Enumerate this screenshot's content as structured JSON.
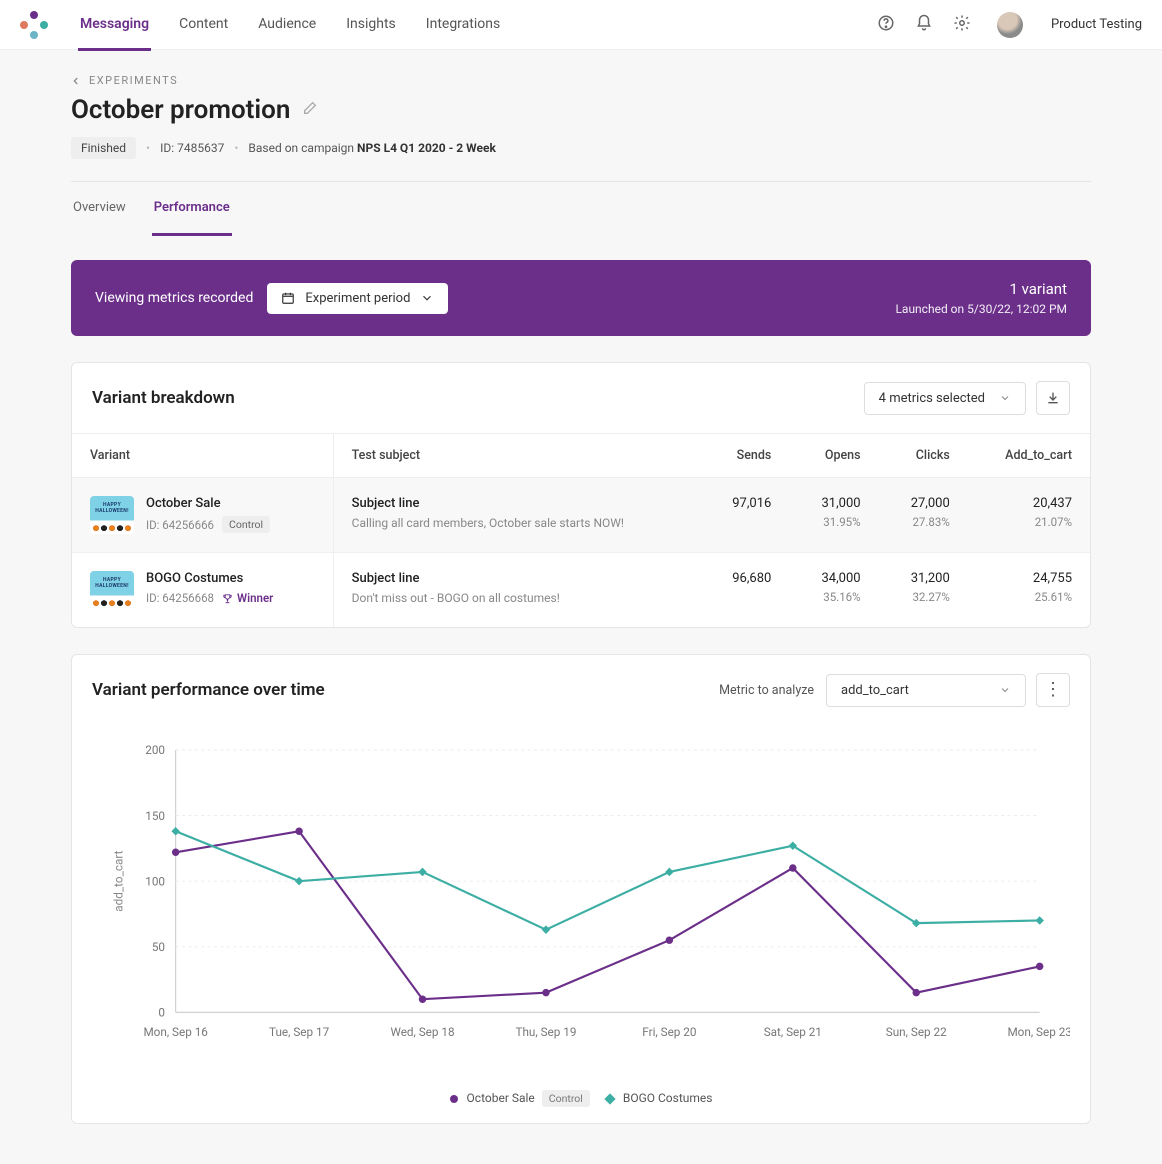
{
  "nav": {
    "items": [
      {
        "label": "Messaging",
        "active": true
      },
      {
        "label": "Content"
      },
      {
        "label": "Audience"
      },
      {
        "label": "Insights"
      },
      {
        "label": "Integrations"
      }
    ],
    "user_label": "Product Testing"
  },
  "header": {
    "breadcrumb": "EXPERIMENTS",
    "title": "October promotion",
    "status_badge": "Finished",
    "id_label": "ID: 7485637",
    "based_on_prefix": "Based on campaign ",
    "based_on_value": "NPS L4 Q1 2020 - 2 Week",
    "tabs": [
      {
        "label": "Overview"
      },
      {
        "label": "Performance",
        "active": true
      }
    ]
  },
  "banner": {
    "viewing_label": "Viewing metrics recorded",
    "period_select": "Experiment period",
    "variant_count": "1 variant",
    "launched": "Launched on 5/30/22, 12:02 PM"
  },
  "breakdown": {
    "title": "Variant breakdown",
    "metrics_select": "4 metrics selected",
    "columns": [
      "Variant",
      "Test subject",
      "Sends",
      "Opens",
      "Clicks",
      "Add_to_cart"
    ],
    "rows": [
      {
        "name": "October Sale",
        "id": "ID: 64256666",
        "control": true,
        "winner": false,
        "subject_label": "Subject line",
        "subject_text": "Calling all card members, October sale starts NOW!",
        "sends": "97,016",
        "opens": "31,000",
        "opens_pct": "31.95%",
        "clicks": "27,000",
        "clicks_pct": "27.83%",
        "add_to_cart": "20,437",
        "add_to_cart_pct": "21.07%"
      },
      {
        "name": "BOGO Costumes",
        "id": "ID: 64256668",
        "control": false,
        "winner": true,
        "winner_label": "Winner",
        "subject_label": "Subject line",
        "subject_text": "Don't  miss out - BOGO on all costumes!",
        "sends": "96,680",
        "opens": "34,000",
        "opens_pct": "35.16%",
        "clicks": "31,200",
        "clicks_pct": "32.27%",
        "add_to_cart": "24,755",
        "add_to_cart_pct": "25.61%"
      }
    ],
    "control_badge": "Control"
  },
  "perf": {
    "title": "Variant performance over time",
    "analyze_label": "Metric to analyze",
    "analyze_value": "add_to_cart",
    "legend": {
      "a": "October Sale",
      "a_control": "Control",
      "b": "BOGO Costumes"
    }
  },
  "chart_data": {
    "type": "line",
    "ylabel": "add_to_cart",
    "ylim": [
      0,
      200
    ],
    "yticks": [
      0,
      50,
      100,
      150,
      200
    ],
    "categories": [
      "Mon, Sep 16",
      "Tue, Sep 17",
      "Wed, Sep 18",
      "Thu, Sep 19",
      "Fri, Sep 20",
      "Sat, Sep 21",
      "Sun, Sep 22",
      "Mon, Sep 23"
    ],
    "series": [
      {
        "name": "October Sale",
        "control": true,
        "color": "#6b2f8a",
        "marker": "circle",
        "values": [
          122,
          138,
          10,
          15,
          55,
          110,
          15,
          35
        ]
      },
      {
        "name": "BOGO Costumes",
        "color": "#3caea3",
        "marker": "diamond",
        "values": [
          138,
          100,
          107,
          63,
          107,
          127,
          68,
          70
        ]
      }
    ]
  }
}
